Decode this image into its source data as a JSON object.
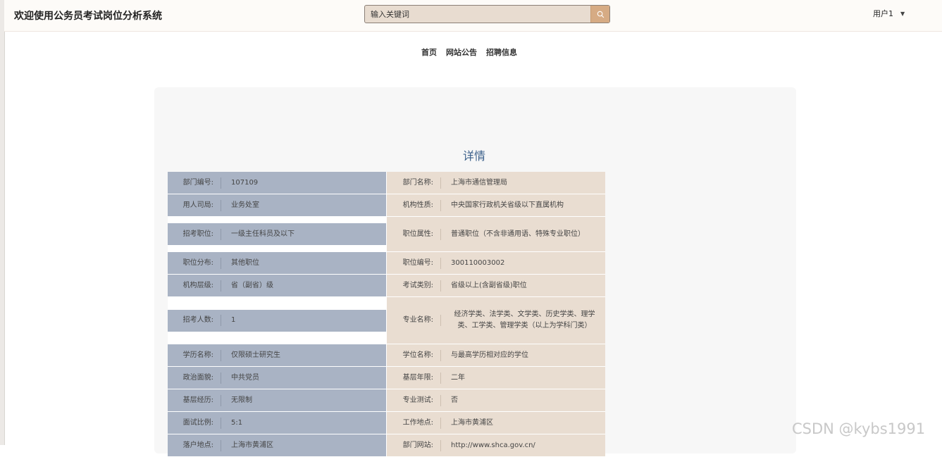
{
  "header": {
    "title": "欢迎使用公务员考试岗位分析系统",
    "search_placeholder": "输入关键词",
    "user": "用户1"
  },
  "nav": [
    "首页",
    "网站公告",
    "招聘信息"
  ],
  "detail_title": "详情",
  "rows": [
    {
      "l_label": "部门编号:",
      "l_value": "107109",
      "r_label": "部门名称:",
      "r_value": "上海市通信管理局"
    },
    {
      "l_label": "用人司局:",
      "l_value": "业务处室",
      "r_label": "机构性质:",
      "r_value": "中央国家行政机关省级以下直属机构"
    },
    {
      "l_label": "招考职位:",
      "l_value": "一级主任科员及以下",
      "r_label": "职位属性:",
      "r_value": "普通职位（不含非通用语、特殊专业职位）"
    },
    {
      "l_label": "职位分布:",
      "l_value": "其他职位",
      "r_label": "职位编号:",
      "r_value": "300110003002"
    },
    {
      "l_label": "机构层级:",
      "l_value": "省（副省）级",
      "r_label": "考试类别:",
      "r_value": "省级以上(含副省级)职位"
    },
    {
      "l_label": "招考人数:",
      "l_value": "1",
      "r_label": "专业名称:",
      "r_value": "经济学类、法学类、文学类、历史学类、理学类、工学类、管理学类（以上为学科门类）"
    },
    {
      "l_label": "学历名称:",
      "l_value": "仅限硕士研究生",
      "r_label": "学位名称:",
      "r_value": "与最高学历相对应的学位"
    },
    {
      "l_label": "政治面貌:",
      "l_value": "中共党员",
      "r_label": "基层年限:",
      "r_value": "二年"
    },
    {
      "l_label": "基层经历:",
      "l_value": "无限制",
      "r_label": "专业测试:",
      "r_value": "否"
    },
    {
      "l_label": "面试比例:",
      "l_value": "5:1",
      "r_label": "工作地点:",
      "r_value": "上海市黄浦区"
    },
    {
      "l_label": "落户地点:",
      "l_value": "上海市黄浦区",
      "r_label": "部门网站:",
      "r_value": "http://www.shca.gov.cn/"
    }
  ],
  "watermark": "CSDN @kybs1991"
}
